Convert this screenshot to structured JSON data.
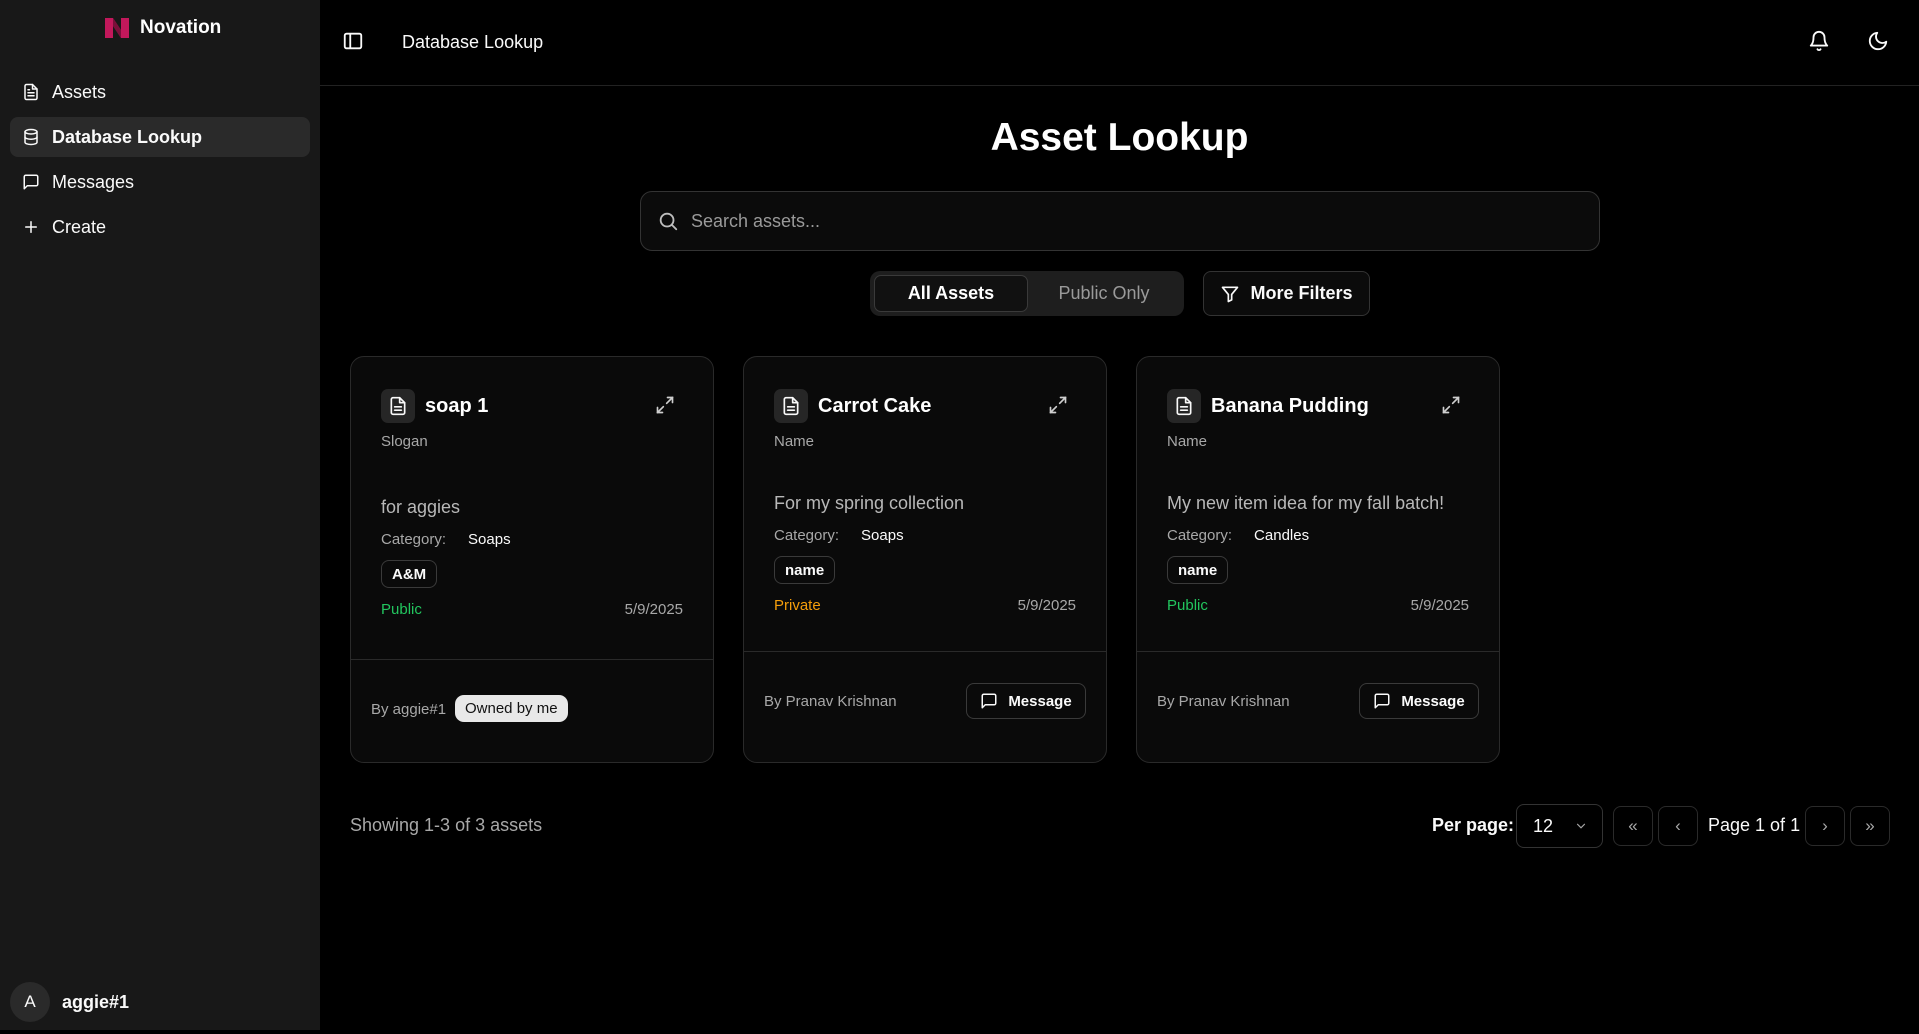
{
  "sidebar": {
    "brand": "Novation",
    "items": [
      {
        "label": "Assets",
        "icon": "file-icon"
      },
      {
        "label": "Database Lookup",
        "icon": "database-icon"
      },
      {
        "label": "Messages",
        "icon": "message-icon"
      },
      {
        "label": "Create",
        "icon": "plus-icon"
      }
    ],
    "user": {
      "initial": "A",
      "name": "aggie#1"
    }
  },
  "header": {
    "breadcrumb": "Database Lookup"
  },
  "main": {
    "title": "Asset Lookup",
    "search": {
      "placeholder": "Search assets...",
      "value": ""
    },
    "tabs": [
      {
        "label": "All Assets"
      },
      {
        "label": "Public Only"
      }
    ],
    "more_filters": "More Filters",
    "cards": [
      {
        "title": "soap 1",
        "subtitle": "Slogan",
        "description": "for aggies",
        "category_label": "Category:",
        "category": "Soaps",
        "tag": "A&M",
        "visibility": "Public",
        "date": "5/9/2025",
        "by": "By aggie#1",
        "owned": "Owned by me"
      },
      {
        "title": "Carrot Cake",
        "subtitle": "Name",
        "description": "For my spring collection",
        "category_label": "Category:",
        "category": "Soaps",
        "tag": "name",
        "visibility": "Private",
        "date": "5/9/2025",
        "by": "By Pranav Krishnan",
        "action": "Message"
      },
      {
        "title": "Banana Pudding",
        "subtitle": "Name",
        "description": "My new item idea for my fall batch!",
        "category_label": "Category:",
        "category": "Candles",
        "tag": "name",
        "visibility": "Public",
        "date": "5/9/2025",
        "by": "By Pranav Krishnan",
        "action": "Message"
      }
    ],
    "pagination": {
      "showing": "Showing 1-3 of 3 assets",
      "per_page_label": "Per page:",
      "per_page_value": "12",
      "first": "«",
      "prev": "‹",
      "next": "›",
      "last": "»",
      "page_info": "Page 1 of 1"
    }
  },
  "colors": {
    "public": "#22c55e",
    "private": "#f59e0b",
    "brand": "#c2185b"
  }
}
